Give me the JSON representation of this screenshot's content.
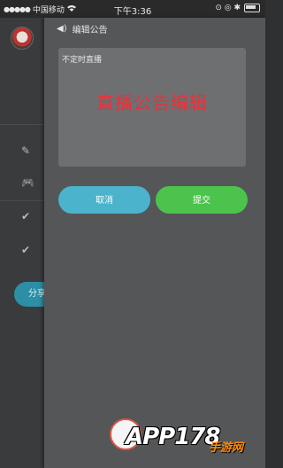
{
  "status_bar": {
    "signal_dots": "●●●●●",
    "carrier": "中国移动",
    "wifi_icon": "wifi-icon",
    "time": "下午3:36",
    "indicators": "⊙ ◎ ✱"
  },
  "drawer": {
    "share_label": "分享"
  },
  "panel": {
    "title": "编辑公告",
    "notice_text": "不定时直播",
    "overlay_caption": "直播公告编辑",
    "cancel_label": "取消",
    "submit_label": "提交"
  },
  "watermark": {
    "brand": "APP178",
    "suffix": "手游网"
  },
  "colors": {
    "cancel": "#4bb3cc",
    "submit": "#4cc34c",
    "caption": "#e8323a"
  }
}
